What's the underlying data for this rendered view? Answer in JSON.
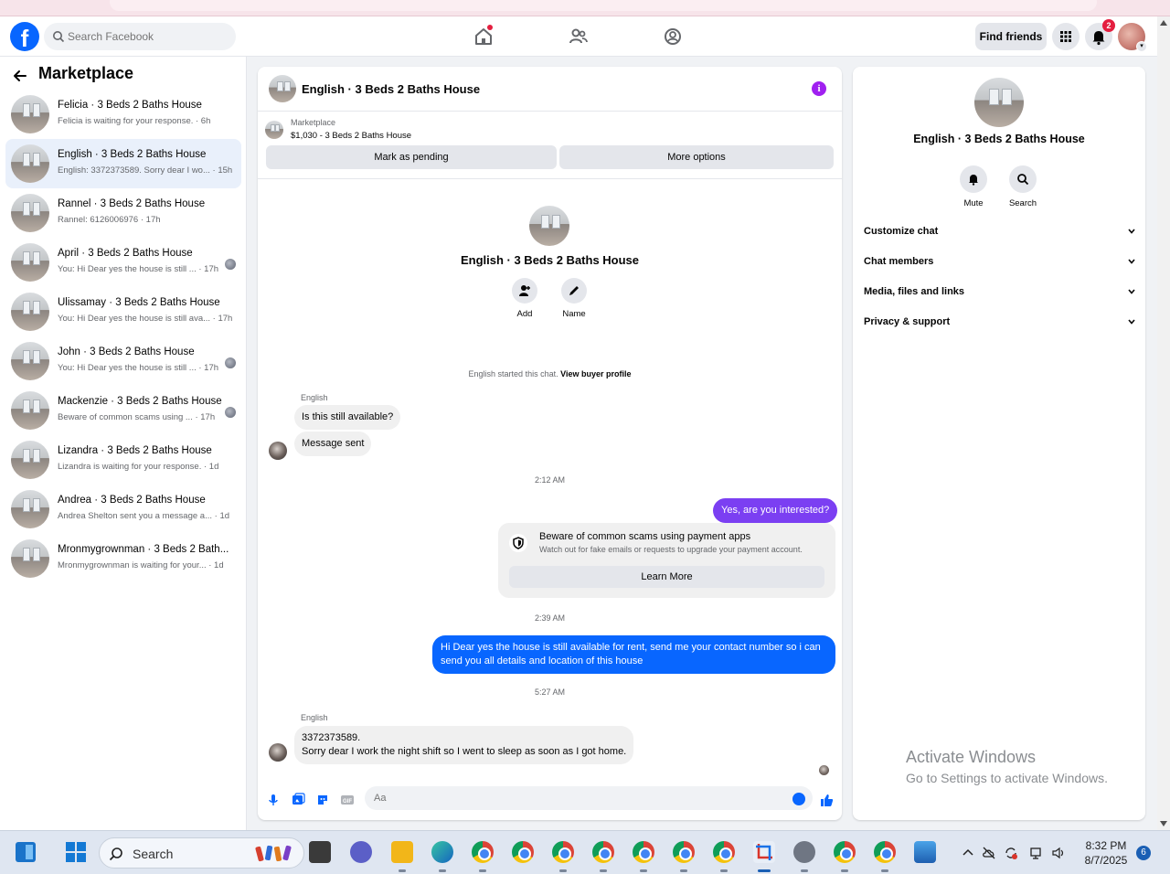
{
  "nav": {
    "logo": "f",
    "search_placeholder": "Search Facebook",
    "find_friends": "Find friends",
    "notification_count": "2"
  },
  "sidebar": {
    "title": "Marketplace",
    "conversations": [
      {
        "title": "Felicia · 3 Beds 2 Baths House",
        "snippet": "Felicia is waiting for your response. · 6h"
      },
      {
        "title": "English · 3 Beds 2 Baths House",
        "snippet": "English: 3372373589. Sorry dear I wo... · 15h"
      },
      {
        "title": "Rannel · 3 Beds 2 Baths House",
        "snippet": "Rannel: 6126006976 · 17h"
      },
      {
        "title": "April · 3 Beds 2 Baths House",
        "snippet": "You: Hi Dear yes the house is still ... · 17h"
      },
      {
        "title": "Ulissamay · 3 Beds 2 Baths House",
        "snippet": "You: Hi Dear yes the house is still ava... · 17h"
      },
      {
        "title": "John · 3 Beds 2 Baths House",
        "snippet": "You: Hi Dear yes the house is still ... · 17h"
      },
      {
        "title": "Mackenzie · 3 Beds 2 Baths House",
        "snippet": "Beware of common scams using ... · 17h"
      },
      {
        "title": "Lizandra · 3 Beds 2 Baths House",
        "snippet": "Lizandra is waiting for your response. · 1d"
      },
      {
        "title": "Andrea · 3 Beds 2 Baths House",
        "snippet": "Andrea Shelton sent you a message a... · 1d"
      },
      {
        "title": "Mronmygrownman · 3 Beds 2 Bath...",
        "snippet": "Mronmygrownman is waiting for your... · 1d"
      }
    ]
  },
  "chat": {
    "title": "English · 3 Beds 2 Baths House",
    "listing_label": "Marketplace",
    "listing_price": "$1,030 - 3 Beds 2 Baths House",
    "mark_pending": "Mark as pending",
    "more_options": "More options",
    "intro_title": "English · 3 Beds 2 Baths House",
    "add_label": "Add",
    "name_label": "Name",
    "started_text": "English started this chat.",
    "view_buyer": "View buyer profile",
    "sender1": "English",
    "msg1": "Is this still available?",
    "msg2": "Message sent",
    "time1": "2:12 AM",
    "reply1": "Yes, are you interested?",
    "scam_title": "Beware of common scams using payment apps",
    "scam_sub": "Watch out for fake emails or requests to upgrade your payment account.",
    "learn_more": "Learn More",
    "time2": "2:39 AM",
    "reply2": "Hi Dear yes the house is still available for rent, send me your contact number so i can send you all details and location of this house",
    "time3": "5:27 AM",
    "sender2": "English",
    "msg3_line1": "3372373589.",
    "msg3_line2": "Sorry dear I work the night shift so I went to sleep as soon as I got home.",
    "composer_placeholder": "Aa"
  },
  "panel": {
    "title": "English · 3 Beds 2 Baths House",
    "mute": "Mute",
    "search": "Search",
    "rows": [
      "Customize chat",
      "Chat members",
      "Media, files and links",
      "Privacy & support"
    ]
  },
  "watermark": {
    "line1": "Activate Windows",
    "line2": "Go to Settings to activate Windows."
  },
  "taskbar": {
    "search": "Search",
    "time": "8:32 PM",
    "date": "8/7/2025",
    "notifications": "6"
  },
  "colors": {
    "accent": "#0866ff",
    "purple_bubble": "#7b3ff2",
    "info": "#a020f0"
  }
}
